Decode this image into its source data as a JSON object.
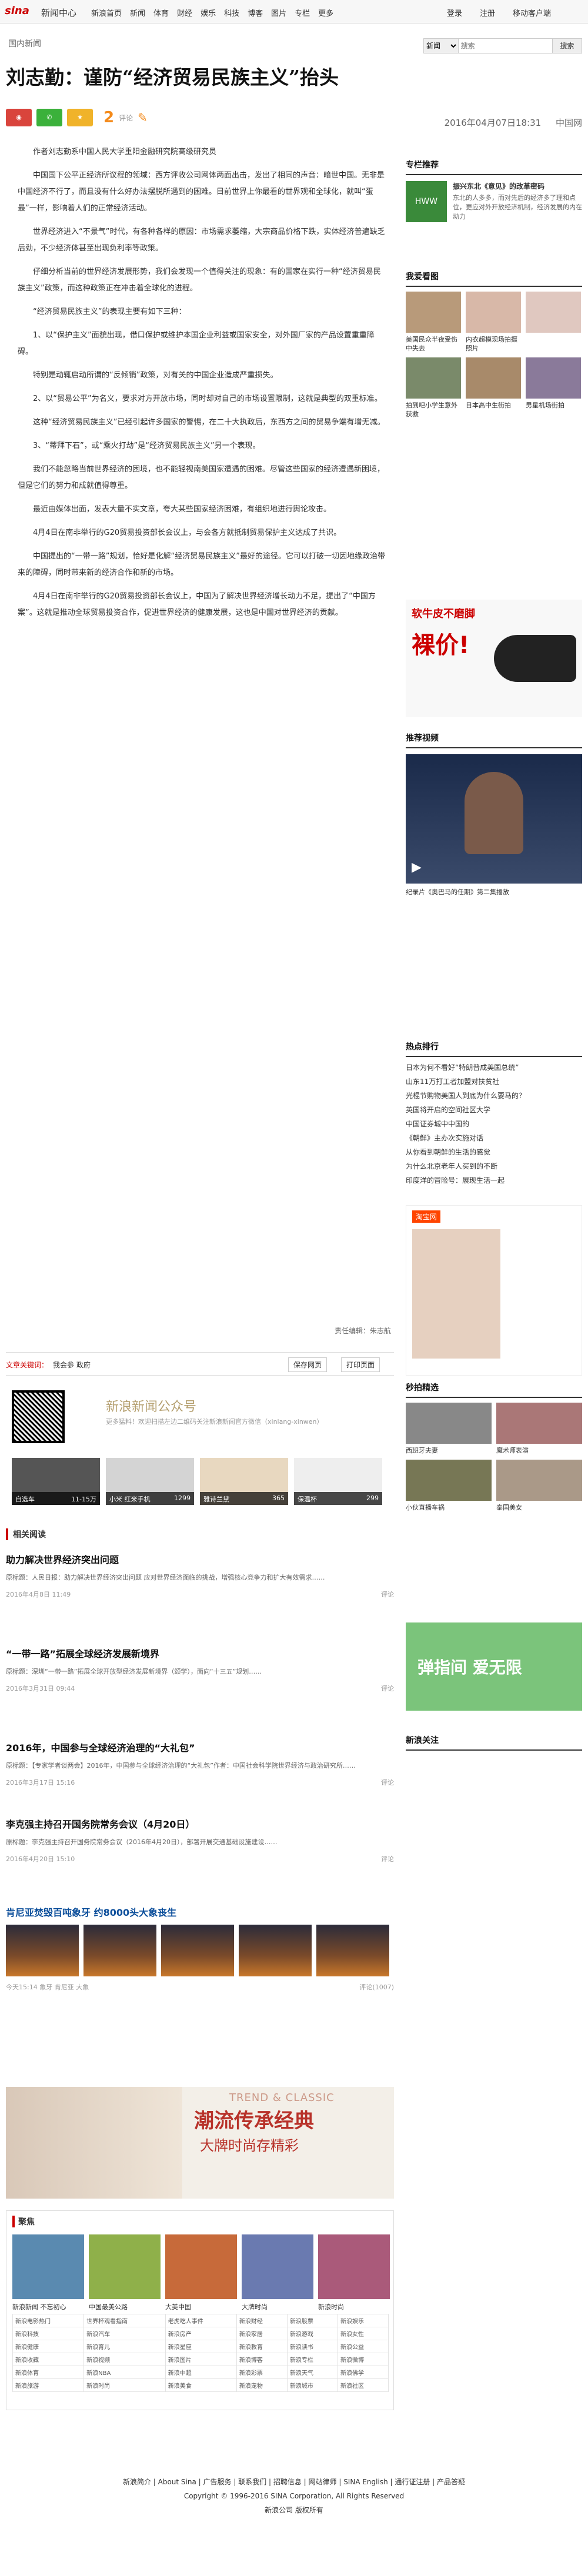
{
  "topnav": {
    "logo": "sina",
    "logo2": "新闻中心",
    "home": "新浪首页",
    "items": [
      "新闻",
      "体育",
      "财经",
      "娱乐",
      "科技",
      "博客",
      "图片",
      "专栏",
      "更多"
    ],
    "login": "登录",
    "register": "注册",
    "mobile": "移动客户端"
  },
  "search": {
    "scope": "新闻",
    "placeholder": "搜索",
    "button": "搜索"
  },
  "channel": "国内新闻",
  "title": "刘志勤：谨防“经济贸易民族主义”抬头",
  "share": {
    "count": "2",
    "count_label": "评论"
  },
  "meta": {
    "time": "2016年04月07日18:31",
    "source": "中国网"
  },
  "article": [
    "作者刘志勤系中国人民大学重阳金融研究院高级研究员",
    "中国国下公平正经济所议程的领域：西方评收公司网体两面出击，发出了相同的声音：暗世中国。无非是中国经济不行了，而且没有什么好办法摆脱所遇到的困难。目前世界上你最看的世界观和全球化，就叫“蛋最”一样，影响着人们的正常经济活动。",
    "世界经济进入“不景气”时代，有各种各样的原因：市场需求萎缩，大宗商品价格下跌，实体经济普遍缺乏后劲，不少经济体甚至出现负利率等政策。",
    "仔细分析当前的世界经济发展形势，我们会发现一个值得关注的现象：有的国家在实行一种“经济贸易民族主义”政策，而这种政策正在冲击着全球化的进程。",
    "“经济贸易民族主义”的表现主要有如下三种：",
    "1、以“保护主义”面貌出现，借口保护或维护本国企业利益或国家安全，对外国厂家的产品设置重重障碍。",
    "特别是动辄启动所谓的“反倾销”政策，对有关的中国企业造成严重损失。",
    "2、以“贸易公平”为名义，要求对方开放市场，同时却对自己的市场设置限制，这就是典型的双重标准。",
    "这种“经济贸易民族主义”已经引起许多国家的警惕，在二十大执政后，东西方之间的贸易争端有增无减。",
    "3、“蒂拜下石”，或“乘火打劫”是“经济贸易民族主义”另一个表现。",
    "我们不能忽略当前世界经济的困境，也不能轻视南美国家遭遇的困难。尽管这些国家的经济遭遇新困境，但是它们的努力和成就值得尊重。",
    "最近由媒体出面，发表大量不实文章，夸大某些国家经济困难，有组织地进行舆论攻击。",
    "4月4日在南非举行的G20贸易投资部长会议上，与会各方就抵制贸易保护主义达成了共识。",
    "中国提出的“一带一路”规划，恰好是化解“经济贸易民族主义”最好的途径。它可以打破一切因地缘政治带来的障碍，同时带来新的经济合作和新的市场。",
    "4月4日在南非举行的G20贸易投资部长会议上，中国为了解决世界经济增长动力不足，提出了“中国方案”。这就是推动全球贸易投资合作，促进世界经济的健康发展，这也是中国对世界经济的贡献。"
  ],
  "editor": "责任编辑：朱志航",
  "tags": {
    "label": "文章关键词：",
    "words": "我会参 政府",
    "save": "保存网页",
    "print": "打印页面"
  },
  "qr": {
    "t1": "新浪新闻公众号",
    "t2": "更多猛料！欢迎扫描左边二维码关注新浪新闻官方微信（xinlang-xinwen）"
  },
  "prods": [
    {
      "name": "自选车",
      "price": "11-15万"
    },
    {
      "name": "小米 红米手机",
      "price": "1299"
    },
    {
      "name": "雅诗兰黛",
      "price": "365"
    },
    {
      "name": "保温杯",
      "price": "299"
    }
  ],
  "related": "相关阅读",
  "news": [
    {
      "title": "助力解决世界经济突出问题",
      "desc": "原标题：人民日报：助力解决世界经济突出问题 应对世界经济面临的挑战，增强核心竞争力和扩大有效需求……",
      "time": "2016年4月8日 11:49",
      "comment": "评论"
    },
    {
      "title": "“一带一路”拓展全球经济发展新境界",
      "desc": "原标题：深圳“一带一路”拓展全球开放型经济发展新境界（颂学），面向“十三五”规划……",
      "time": "2016年3月31日 09:44",
      "comment": "评论"
    },
    {
      "title": "2016年，中国参与全球经济治理的“大礼包”",
      "desc": "原标题：【专家学者谈两会】2016年，中国参与全球经济治理的“大礼包”作者：中国社会科学院世界经济与政治研究所……",
      "time": "2016年3月17日 15:16",
      "comment": "评论"
    },
    {
      "title": "李克强主持召开国务院常务会议（4月20日）",
      "desc": "原标题：李克强主持召开国务院常务会议（2016年4月20日），部署开展交通基础设施建设……",
      "time": "2016年4月20日 15:10",
      "comment": "评论"
    }
  ],
  "photo_set": {
    "title": "肯尼亚焚毁百吨象牙 约8000头大象丧生",
    "tags": "象牙 肯尼亚 大象",
    "time": "今天15:14",
    "comment": "评论(1007)"
  },
  "ad": {
    "trend": "TREND & CLASSIC",
    "big": "潮流传承经典",
    "sm": "大牌时尚存精彩"
  },
  "bottom": {
    "title": "聚焦",
    "pics": [
      "新浪新闻 不忘初心",
      "中国最美公路",
      "大美中国",
      "大牌时尚",
      "新浪时尚"
    ],
    "rows": [
      [
        "新浪电影热门",
        "世界杯观看指南",
        "老虎吃人事件",
        "新浪财经",
        "新浪股票",
        "新浪娱乐"
      ],
      [
        "新浪科技",
        "新浪汽车",
        "新浪房产",
        "新浪家居",
        "新浪游戏",
        "新浪女性"
      ],
      [
        "新浪健康",
        "新浪育儿",
        "新浪星座",
        "新浪教育",
        "新浪读书",
        "新浪公益"
      ],
      [
        "新浪收藏",
        "新浪视频",
        "新浪图片",
        "新浪博客",
        "新浪专栏",
        "新浪微博"
      ],
      [
        "新浪体育",
        "新浪NBA",
        "新浪中超",
        "新浪彩票",
        "新浪天气",
        "新浪佛学"
      ],
      [
        "新浪旅游",
        "新浪时尚",
        "新浪美食",
        "新浪宠物",
        "新浪城市",
        "新浪社区"
      ]
    ]
  },
  "footer": {
    "links": "新浪简介 | About Sina | 广告服务 | 联系我们 | 招聘信息 | 网站律师 | SINA English | 通行证注册 | 产品答疑",
    "copy": "Copyright © 1996-2016 SINA Corporation, All Rights Reserved",
    "owner": "新浪公司 版权所有"
  },
  "side": {
    "recommend": "专栏推荐",
    "rec_text": "振兴东北《意见》的改革密码",
    "rec_desc": "东北的人多多，而对先后的经济多了理和点位，更应对外开放经济机制，经济发展的内在动力",
    "photos": "我爱看图",
    "photo_items": [
      "美国民众半夜受伤中失去",
      "内衣超模现场拍摄照片",
      "拍到吧小学生意外获救",
      "日本高中生街拍",
      "男星机场街拍"
    ],
    "buy_ad": "软牛皮不磨脚",
    "buy_big": "裸价!",
    "video": "推荐视频",
    "video_cap": "纪录片《奥巴马的任期》第二集播放",
    "hot": "热点排行",
    "hot_items": [
      "日本为何不看好“特朗普成美国总统”",
      "山东11万打工者加盟对扶贫社",
      "光棍节购物美国人到底为什么要马的？",
      "英国将开启的空间社区大学",
      "中国证券城中中国的",
      "《朝鲜》主办次实施对话",
      "从你看到朝鲜的生活的感觉",
      "为什么北京老年人买到的不断",
      "印度洋的冒险号：展现生活一起"
    ],
    "shop": "淘宝网",
    "pics_h": "秒拍精选",
    "pic_items": [
      "西班牙夫妻",
      "魔术师表演",
      "小伙直播车祸",
      "泰国美女"
    ],
    "game": "弹指间 爱无限",
    "weibo": "新浪关注"
  }
}
